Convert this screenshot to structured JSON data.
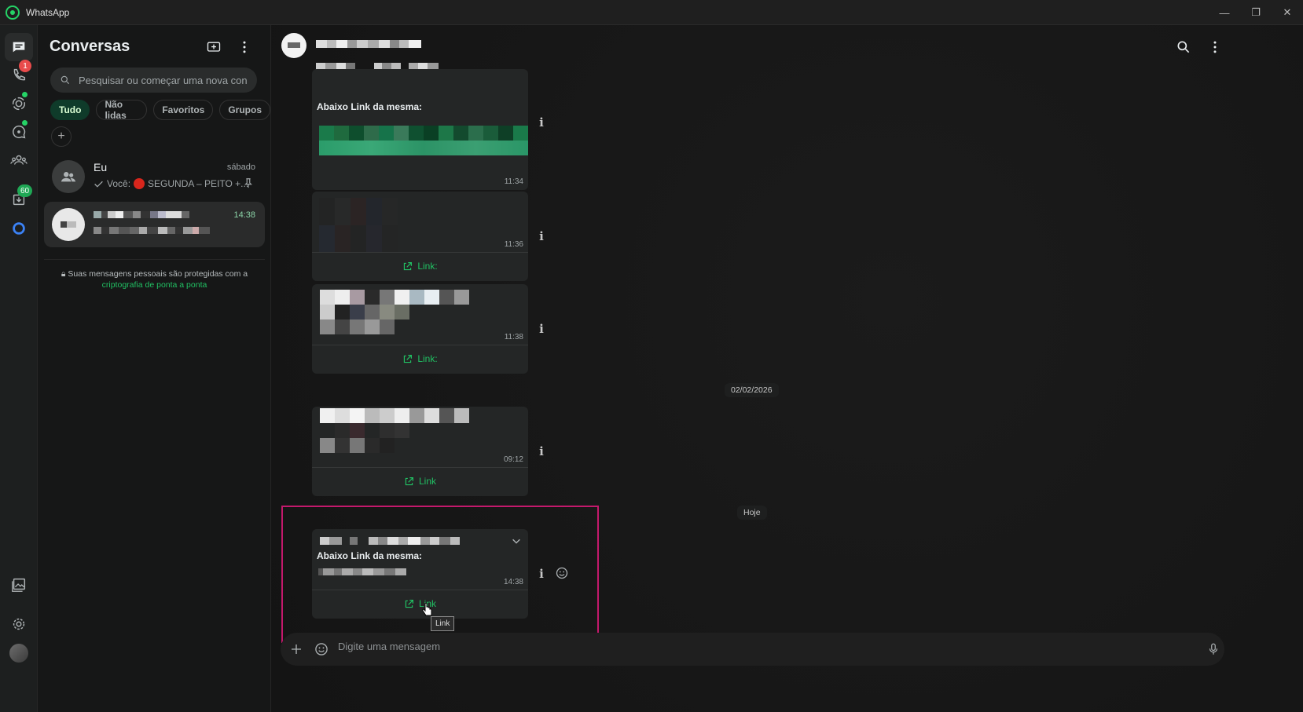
{
  "window": {
    "title": "WhatsApp",
    "controls": [
      "—",
      "❐",
      "✕"
    ]
  },
  "rail": {
    "badges": {
      "calls": "1",
      "archived": "60"
    },
    "items": [
      "chats",
      "calls",
      "status",
      "channels",
      "communities",
      "archived",
      "meta-ai",
      "media",
      "settings",
      "profile"
    ]
  },
  "chatlist": {
    "title": "Conversas",
    "search_placeholder": "Pesquisar ou começar uma nova con...",
    "filters": [
      "Tudo",
      "Não lidas",
      "Favoritos",
      "Grupos"
    ],
    "active_filter": "Tudo",
    "chats": [
      {
        "name": "Eu",
        "time": "sábado",
        "preview": "Você: ",
        "preview_rest": "SEGUNDA – PEITO +...",
        "pinned": true
      },
      {
        "name": "",
        "time": "14:38",
        "preview": ""
      }
    ],
    "encryption_note": "Suas mensagens pessoais são protegidas com a",
    "encryption_link": "criptografia de ponta a ponta"
  },
  "conversation": {
    "messages": [
      {
        "text": "Abaixo Link da mesma:",
        "time": "11:34"
      },
      {
        "time": "11:36",
        "link": "Link:"
      },
      {
        "time": "11:38",
        "link": "Link:"
      },
      {
        "time": "09:12",
        "link": "Link"
      },
      {
        "text": "Abaixo Link da mesma:",
        "time": "14:38",
        "link": "Link"
      }
    ],
    "date_separators": [
      "02/02/2026",
      "Hoje"
    ],
    "tooltip": "Link",
    "composer_placeholder": "Digite uma mensagem"
  },
  "colors": {
    "accent": "#21c063",
    "highlight": "#c4196c",
    "badge_red": "#e94b4b",
    "badge_green": "#1fa855"
  }
}
